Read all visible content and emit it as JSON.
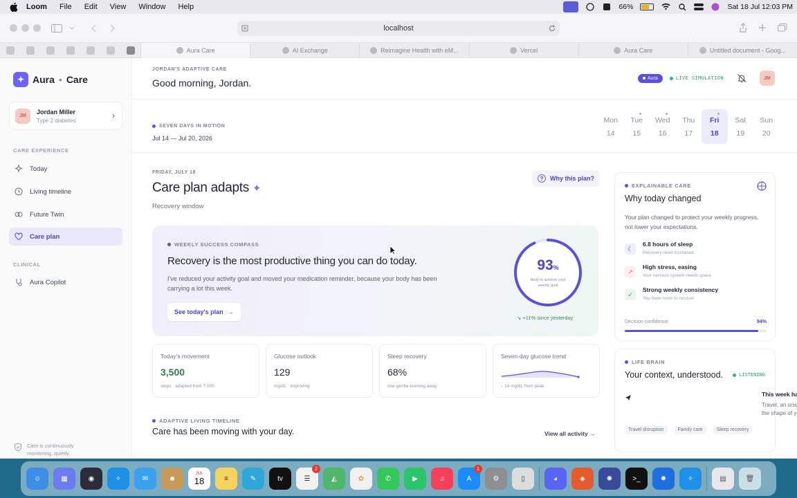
{
  "menubar": {
    "app": "Loom",
    "items": [
      "File",
      "Edit",
      "View",
      "Window",
      "Help"
    ],
    "battery": "66%",
    "clock": "Sat 18 Jul  12:03 PM"
  },
  "browser": {
    "url": "localhost",
    "tabs": [
      "Aura Care",
      "AI Exchange",
      "Reimagine Health with eM...",
      "Vercel",
      "Aura Care",
      "Untitled document - Goog..."
    ],
    "active_tab": 0
  },
  "sidebar": {
    "brand": "Aura",
    "brand_sep": "•",
    "brand_suffix": "Care",
    "user": {
      "initials": "JM",
      "name": "Jordan Miller",
      "condition": "Type 2 diabetes"
    },
    "section_experience": "CARE EXPERIENCE",
    "items": [
      {
        "label": "Today"
      },
      {
        "label": "Living timeline"
      },
      {
        "label": "Future Twin"
      },
      {
        "label": "Care plan"
      }
    ],
    "section_clinical": "CLINICAL",
    "clinical_items": [
      {
        "label": "Aura Copilot"
      }
    ],
    "footer": "Care is continuously monitoring, quietly."
  },
  "header": {
    "eyebrow": "JORDAN'S ADAPTIVE CARE",
    "greeting": "Good morning, Jordan.",
    "pill": "Aura",
    "live": "LIVE SIMULATION",
    "initials": "JM"
  },
  "week": {
    "eyebrow": "SEVEN DAYS IN MOTION",
    "range": "Jul 14 — Jul 20, 2026",
    "days": [
      {
        "name": "Mon",
        "date": "14"
      },
      {
        "name": "Tue",
        "date": "15"
      },
      {
        "name": "Wed",
        "date": "16"
      },
      {
        "name": "Thu",
        "date": "17"
      },
      {
        "name": "Fri",
        "date": "18"
      },
      {
        "name": "Sat",
        "date": "19"
      },
      {
        "name": "Sun",
        "date": "20"
      }
    ]
  },
  "plan": {
    "date": "FRIDAY, JULY 18",
    "title": "Care plan adapts",
    "subtitle": "Recovery window",
    "why_button": "Why this plan?"
  },
  "compass": {
    "eyebrow": "WEEKLY SUCCESS COMPASS",
    "title": "Recovery is the most productive thing you can do today.",
    "body": "I've reduced your activity goal and moved your medication reminder, because your body has been carrying a lot this week.",
    "cta": "See today's plan",
    "score": 93,
    "score_unit": "%",
    "score_label": "likely to achieve your weekly goal",
    "since": "↘ +11% since yesterday"
  },
  "metrics": [
    {
      "label": "Today's movement",
      "value": "3,500",
      "sub": "steps · adapted from 7,000"
    },
    {
      "label": "Glucose outlook",
      "value": "129",
      "sub": "mg/dL · improving"
    },
    {
      "label": "Sleep recovery",
      "value": "68%",
      "sub": "one gentle evening away"
    },
    {
      "label": "Seven-day glucose trend",
      "value": "",
      "sub": "↓ 14 mg/dL from peak"
    }
  ],
  "timeline": {
    "eyebrow": "ADAPTIVE LIVING TIMELINE",
    "title": "Care has been moving with your day.",
    "view_all": "View all activity"
  },
  "explain": {
    "eyebrow": "EXPLAINABLE CARE",
    "title": "Why today changed",
    "desc": "Your plan changed to protect your weekly progress, not lower your expectations.",
    "reasons": [
      {
        "title": "6.8 hours of sleep",
        "sub": "Recovery need increased"
      },
      {
        "title": "High stress, easing",
        "sub": "Your nervous system needs space"
      },
      {
        "title": "Strong weekly consistency",
        "sub": "You have room to recover"
      }
    ],
    "confidence_label": "Decision confidence",
    "confidence_value": "94%",
    "confidence": 0.94
  },
  "lifebrain": {
    "eyebrow": "LIFE BRAIN",
    "title": "Your context, understood.",
    "status": "LISTENING",
    "insight_title": "This week has been different.",
    "insight_body": "Travel, an unwell child and disrupted sleep changed the shape of your week.",
    "chips": [
      "Travel disruption",
      "Family care",
      "Sleep recovery"
    ]
  },
  "dock": {
    "calendar_month": "JUL",
    "calendar_day": "18",
    "reminders_badge": "2",
    "appstore_badge": "1"
  }
}
